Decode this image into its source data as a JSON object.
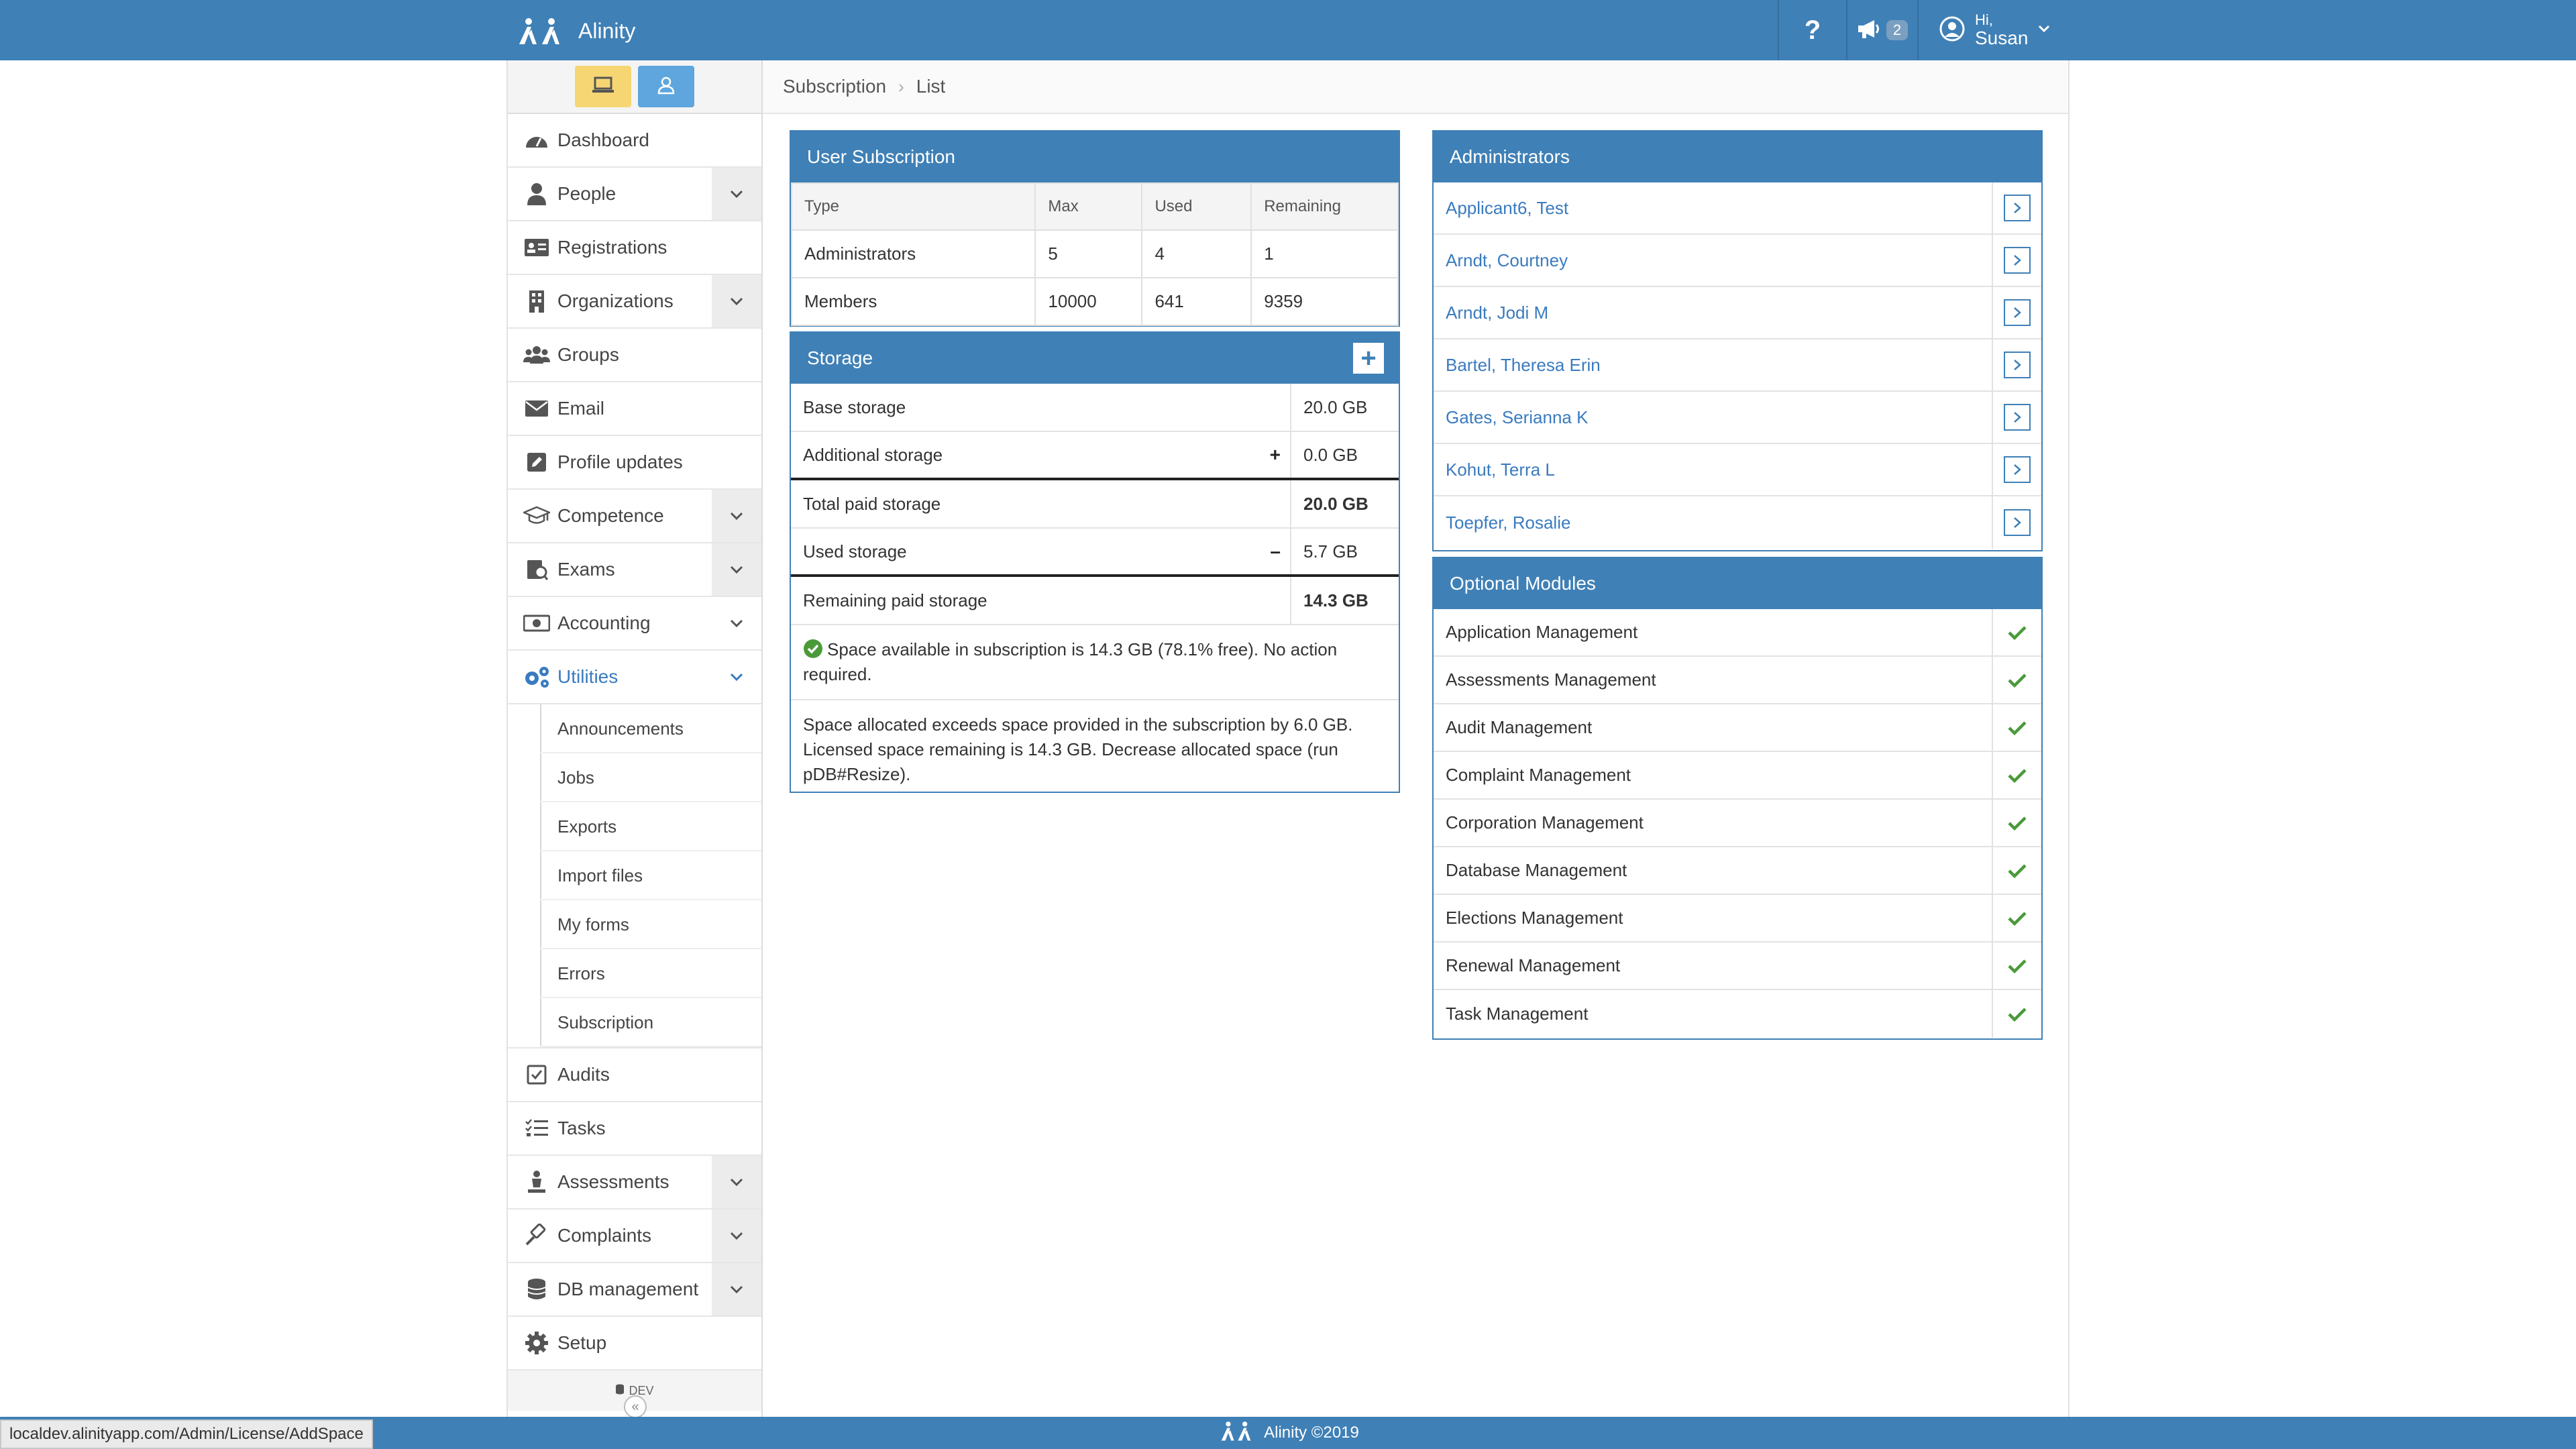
{
  "header": {
    "brand": "Alinity",
    "help": "?",
    "notification_count": "2",
    "greeting": "Hi,",
    "user_name": "Susan"
  },
  "sidebar": {
    "items": [
      {
        "label": "Dashboard",
        "icon": "dashboard-icon",
        "chevron": false
      },
      {
        "label": "People",
        "icon": "person-icon",
        "chevron": true
      },
      {
        "label": "Registrations",
        "icon": "id-card-icon",
        "chevron": false
      },
      {
        "label": "Organizations",
        "icon": "building-icon",
        "chevron": true
      },
      {
        "label": "Groups",
        "icon": "users-icon",
        "chevron": false
      },
      {
        "label": "Email",
        "icon": "envelope-icon",
        "chevron": false
      },
      {
        "label": "Profile updates",
        "icon": "edit-icon",
        "chevron": false
      },
      {
        "label": "Competence",
        "icon": "graduation-cap-icon",
        "chevron": true
      },
      {
        "label": "Exams",
        "icon": "exam-icon",
        "chevron": true
      },
      {
        "label": "Accounting",
        "icon": "money-icon",
        "chevron": true
      },
      {
        "label": "Utilities",
        "icon": "cogs-icon",
        "chevron": true
      }
    ],
    "utilities_sub": [
      "Announcements",
      "Jobs",
      "Exports",
      "Import files",
      "My forms",
      "Errors",
      "Subscription"
    ],
    "items_after": [
      {
        "label": "Audits",
        "icon": "check-square-icon",
        "chevron": false
      },
      {
        "label": "Tasks",
        "icon": "tasks-icon",
        "chevron": false
      },
      {
        "label": "Assessments",
        "icon": "assessment-icon",
        "chevron": true
      },
      {
        "label": "Complaints",
        "icon": "gavel-icon",
        "chevron": true
      },
      {
        "label": "DB management",
        "icon": "database-icon",
        "chevron": true
      },
      {
        "label": "Setup",
        "icon": "gear-icon",
        "chevron": false
      }
    ],
    "env_label": "DEV",
    "collapse": "«"
  },
  "breadcrumb": {
    "level1": "Subscription",
    "level2": "List"
  },
  "user_subscription": {
    "title": "User Subscription",
    "columns": [
      "Type",
      "Max",
      "Used",
      "Remaining"
    ],
    "rows": [
      [
        "Administrators",
        "5",
        "4",
        "1"
      ],
      [
        "Members",
        "10000",
        "641",
        "9359"
      ]
    ]
  },
  "storage": {
    "title": "Storage",
    "add_label": "+",
    "rows": [
      {
        "label": "Base storage",
        "value": "20.0 GB",
        "op": ""
      },
      {
        "label": "Additional storage",
        "value": "0.0 GB",
        "op": "+"
      },
      {
        "label": "Total paid storage",
        "value": "20.0 GB",
        "op": ""
      },
      {
        "label": "Used storage",
        "value": "5.7 GB",
        "op": "–"
      },
      {
        "label": "Remaining paid storage",
        "value": "14.3 GB",
        "op": ""
      }
    ],
    "message_ok": "Space available in subscription is 14.3 GB (78.1% free). No action required.",
    "message_warn": "Space allocated exceeds space provided in the subscription by 6.0 GB. Licensed space remaining is 14.3 GB. Decrease allocated space (run pDB#Resize)."
  },
  "administrators": {
    "title": "Administrators",
    "items": [
      "Applicant6, Test",
      "Arndt, Courtney",
      "Arndt, Jodi M",
      "Bartel, Theresa Erin",
      "Gates, Serianna K",
      "Kohut, Terra L",
      "Toepfer, Rosalie"
    ]
  },
  "optional_modules": {
    "title": "Optional Modules",
    "items": [
      "Application Management",
      "Assessments Management",
      "Audit Management",
      "Complaint Management",
      "Corporation Management",
      "Database Management",
      "Elections Management",
      "Renewal Management",
      "Task Management"
    ]
  },
  "footer": {
    "text": "Alinity ©2019"
  },
  "status_bar": {
    "url": "localdev.alinityapp.com/Admin/License/AddSpace"
  },
  "colors": {
    "primary": "#3f80b6",
    "accent_yellow": "#f6d673",
    "accent_blue": "#5ea6dd",
    "check_green": "#4a9a3a",
    "link": "#3a7bbf"
  }
}
